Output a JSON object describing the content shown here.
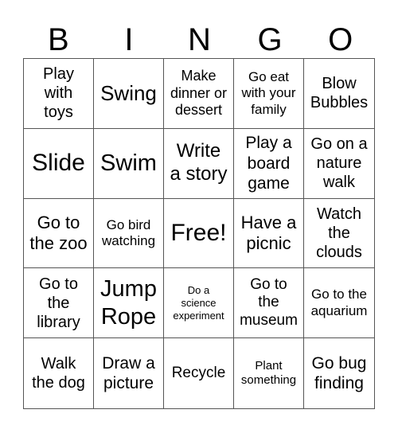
{
  "header": [
    "B",
    "I",
    "N",
    "G",
    "O"
  ],
  "cells": [
    {
      "text": "Play with toys",
      "size": "s20",
      "lines": [
        "Play",
        "with",
        "toys"
      ]
    },
    {
      "text": "Swing",
      "size": "s26",
      "lines": [
        "Swing"
      ]
    },
    {
      "text": "Make dinner or dessert",
      "size": "s18",
      "lines": [
        "Make",
        "dinner or",
        "dessert"
      ]
    },
    {
      "text": "Go eat with your family",
      "size": "s17",
      "lines": [
        "Go eat",
        "with your",
        "family"
      ]
    },
    {
      "text": "Blow Bubbles",
      "size": "s20",
      "lines": [
        "Blow",
        "Bubbles"
      ]
    },
    {
      "text": "Slide",
      "size": "s30",
      "lines": [
        "Slide"
      ]
    },
    {
      "text": "Swim",
      "size": "s29",
      "lines": [
        "Swim"
      ]
    },
    {
      "text": "Write a story",
      "size": "s24",
      "lines": [
        "Write",
        "a story"
      ]
    },
    {
      "text": "Play a board game",
      "size": "s21",
      "lines": [
        "Play a",
        "board",
        "game"
      ]
    },
    {
      "text": "Go on a nature walk",
      "size": "s20",
      "lines": [
        "Go on a",
        "nature",
        "walk"
      ]
    },
    {
      "text": "Go to the zoo",
      "size": "s22",
      "lines": [
        "Go to",
        "the zoo"
      ]
    },
    {
      "text": "Go bird watching",
      "size": "s17",
      "lines": [
        "Go bird",
        "watching"
      ]
    },
    {
      "text": "Free!",
      "size": "s30",
      "lines": [
        "Free!"
      ]
    },
    {
      "text": "Have a picnic",
      "size": "s22",
      "lines": [
        "Have a",
        "picnic"
      ]
    },
    {
      "text": "Watch the clouds",
      "size": "s20",
      "lines": [
        "Watch",
        "the",
        "clouds"
      ]
    },
    {
      "text": "Go to the library",
      "size": "s20",
      "lines": [
        "Go to",
        "the",
        "library"
      ]
    },
    {
      "text": "Jump Rope",
      "size": "s29",
      "lines": [
        "Jump",
        "Rope"
      ]
    },
    {
      "text": "Do a science experiment",
      "size": "s13",
      "lines": [
        "Do a",
        "science",
        "experiment"
      ]
    },
    {
      "text": "Go to the museum",
      "size": "s19",
      "lines": [
        "Go to",
        "the",
        "museum"
      ]
    },
    {
      "text": "Go to the aquarium",
      "size": "s17",
      "lines": [
        "Go to the",
        "aquarium"
      ]
    },
    {
      "text": "Walk the dog",
      "size": "s20",
      "lines": [
        "Walk",
        "the dog"
      ]
    },
    {
      "text": "Draw a picture",
      "size": "s21",
      "lines": [
        "Draw a",
        "picture"
      ]
    },
    {
      "text": "Recycle",
      "size": "s19",
      "lines": [
        "Recycle"
      ]
    },
    {
      "text": "Plant something",
      "size": "s15",
      "lines": [
        "Plant",
        "something"
      ]
    },
    {
      "text": "Go bug finding",
      "size": "s21",
      "lines": [
        "Go bug",
        "finding"
      ]
    }
  ]
}
